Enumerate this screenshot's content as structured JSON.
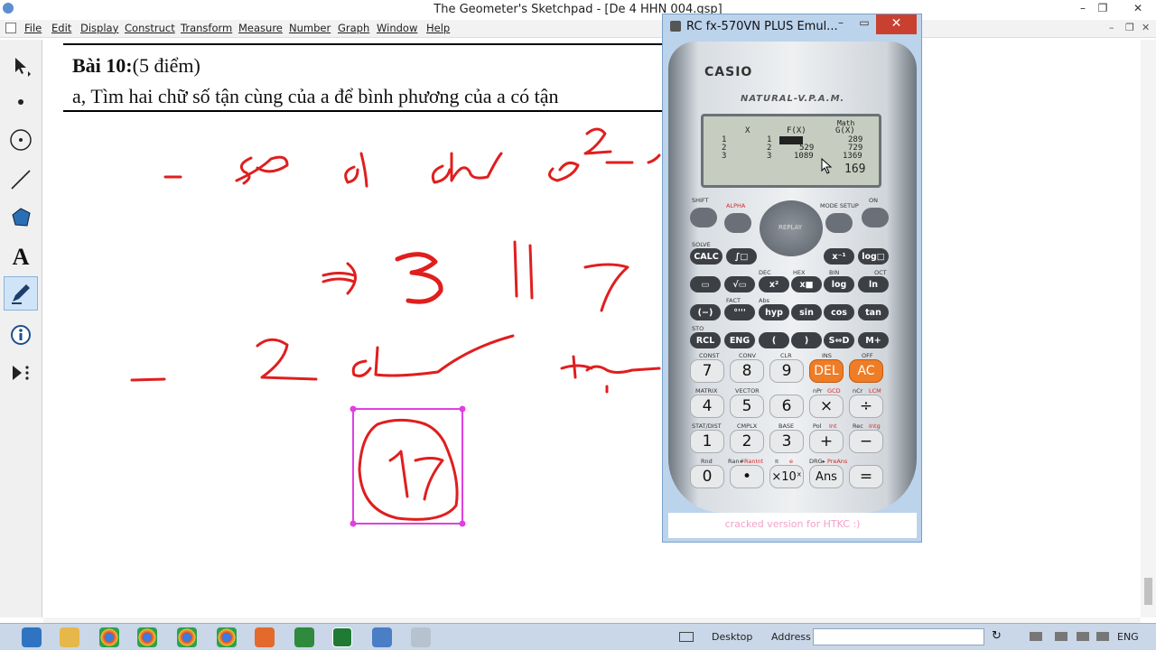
{
  "window": {
    "title": "The Geometer's Sketchpad - [De 4 HHN 004.gsp]",
    "controls": [
      "–",
      "❐",
      "✕"
    ]
  },
  "menubar": {
    "items": [
      "File",
      "Edit",
      "Display",
      "Construct",
      "Transform",
      "Measure",
      "Number",
      "Graph",
      "Window",
      "Help"
    ]
  },
  "toolbox": {
    "tools": [
      "arrow-tool",
      "point-tool",
      "compass-tool",
      "straightedge-tool",
      "polygon-tool",
      "text-tool",
      "marker-tool",
      "information-tool",
      "custom-tool"
    ]
  },
  "document": {
    "heading_bold": "Bài 10:",
    "heading_rest": "(5 điểm)",
    "line_a": "a, Tìm hai chữ số tận cùng của a để bình phương của a có tận"
  },
  "calculator": {
    "title": "RC fx-570VN PLUS Emul...",
    "brand": "CASIO",
    "model": "NATURAL-V.P.A.M.",
    "footer": "cracked version for HTKC :)",
    "lcd": {
      "top_indicators": "Math",
      "col_headers": [
        "X",
        "F(X)",
        "G(X)"
      ],
      "rows": [
        {
          "n": "1",
          "x": "",
          "f": "",
          "g": "289"
        },
        {
          "n": "2",
          "x": "",
          "f": "529",
          "g": "729"
        },
        {
          "n": "3",
          "x": "",
          "f": "1089",
          "g": "1369"
        }
      ],
      "result": "169"
    },
    "top_keys": {
      "shift": "SHIFT",
      "alpha": "ALPHA",
      "mode": "MODE SETUP",
      "on": "ON",
      "replay": "REPLAY"
    },
    "row1": [
      "CALC",
      "∫□",
      "x⁻¹",
      "log□"
    ],
    "row2": [
      "▭",
      "√▭",
      "x²",
      "x■",
      "log",
      "ln"
    ],
    "row3": [
      "(−)",
      "°'''",
      "hyp",
      "sin",
      "cos",
      "tan"
    ],
    "row4": [
      "RCL",
      "ENG",
      "(",
      ")",
      "S⇔D",
      "M+"
    ],
    "num1": [
      "7",
      "8",
      "9",
      "DEL",
      "AC"
    ],
    "num2": [
      "4",
      "5",
      "6",
      "×",
      "÷"
    ],
    "num3": [
      "1",
      "2",
      "3",
      "+",
      "−"
    ],
    "num4": [
      "0",
      "•",
      "×10ˣ",
      "Ans",
      "="
    ],
    "labels": {
      "solve": "SOLVE",
      "const": "CONST",
      "conv": "CONV",
      "clr": "CLR",
      "ins": "INS",
      "off": "OFF",
      "matrix": "MATRIX",
      "vector": "VECTOR",
      "npr": "nPr",
      "gcd": "GCD",
      "ncr": "nCr",
      "lcm": "LCM",
      "stat": "STAT/DIST",
      "cmplx": "CMPLX",
      "base": "BASE",
      "pol": "Pol",
      "int": "Int",
      "rec": "Rec",
      "intg": "Intg",
      "rnd": "Rnd",
      "ran": "Ran#",
      "ranint": "RanInt",
      "pi": "π",
      "e": "e",
      "drg": "DRG▸",
      "preans": "PreAns",
      "sto": "STO",
      "fact": "FACT",
      "abs": "Abs",
      "dec": "DEC",
      "hex": "HEX",
      "bin": "BIN",
      "oct": "OCT"
    }
  },
  "handwriting": {
    "note": "red freehand strokes",
    "stroke_color": "#e01e1e",
    "box_color": "#e040e0"
  },
  "taskbar": {
    "desktop_label": "Desktop",
    "address_label": "Address",
    "language": "ENG"
  }
}
